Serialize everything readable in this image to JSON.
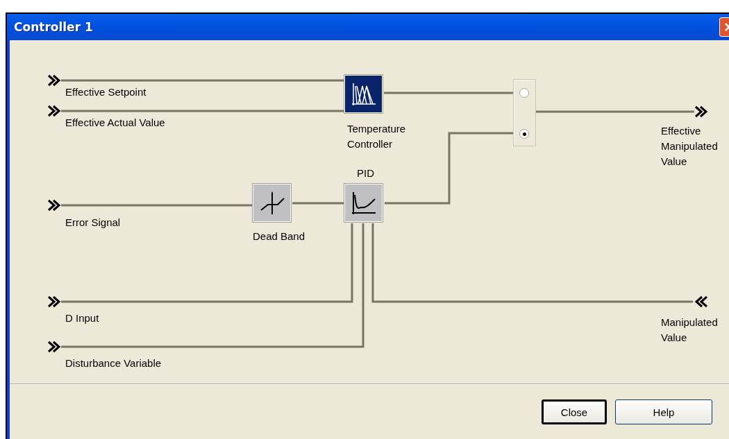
{
  "window": {
    "title": "Controller 1"
  },
  "diagram": {
    "inputs": [
      {
        "label": "Effective Setpoint"
      },
      {
        "label": "Effective Actual Value"
      },
      {
        "label": "Error Signal"
      },
      {
        "label": "D Input"
      },
      {
        "label": "Disturbance Variable"
      }
    ],
    "blocks": [
      {
        "kind": "fuzzy",
        "label": "Temperature Controller",
        "selected": true
      },
      {
        "kind": "deadband",
        "label": "Dead Band",
        "selected": false
      },
      {
        "kind": "pid",
        "label": "PID",
        "selected": false
      }
    ],
    "selector": {
      "options": [
        {
          "selected": false
        },
        {
          "selected": true
        }
      ]
    },
    "outputs": [
      {
        "label": "Effective Manipulated Value",
        "kind": "outgoing"
      },
      {
        "label": "Manipulated Value",
        "kind": "incoming"
      }
    ]
  },
  "buttons": [
    {
      "label": "Close",
      "default": true
    },
    {
      "label": "Help",
      "default": false
    }
  ]
}
